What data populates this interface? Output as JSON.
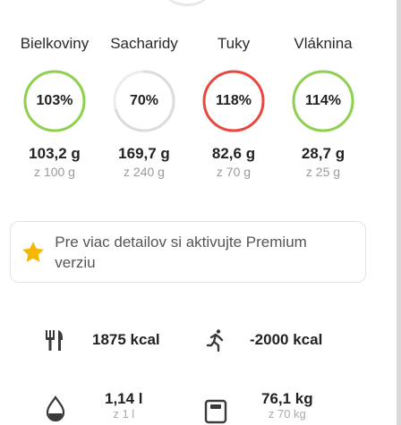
{
  "macros": [
    {
      "label": "Bielkoviny",
      "percent_label": "103%",
      "percent": 103,
      "value": "103,2 g",
      "target": "z 100 g",
      "color": "#8fd14f"
    },
    {
      "label": "Sacharidy",
      "percent_label": "70%",
      "percent": 70,
      "value": "169,7 g",
      "target": "z 240 g",
      "color": "#dcdcdc"
    },
    {
      "label": "Tuky",
      "percent_label": "118%",
      "percent": 118,
      "value": "82,6 g",
      "target": "z 70 g",
      "color": "#e8483f"
    },
    {
      "label": "Vláknina",
      "percent_label": "114%",
      "percent": 114,
      "value": "28,7 g",
      "target": "z 25 g",
      "color": "#8fd14f"
    }
  ],
  "premium": {
    "text": "Pre viac detailov si aktivujte Premium verziu",
    "star_color": "#f5b800"
  },
  "stats": {
    "food": {
      "icon": "cutlery-icon",
      "value": "1875 kcal"
    },
    "exercise": {
      "icon": "running-icon",
      "value": "-2000 kcal"
    },
    "water": {
      "icon": "water-drop-icon",
      "value": "1,14 l",
      "sub": "z 1 l"
    },
    "weight": {
      "icon": "scale-icon",
      "value": "76,1 kg",
      "sub": "z 70 kg"
    }
  }
}
